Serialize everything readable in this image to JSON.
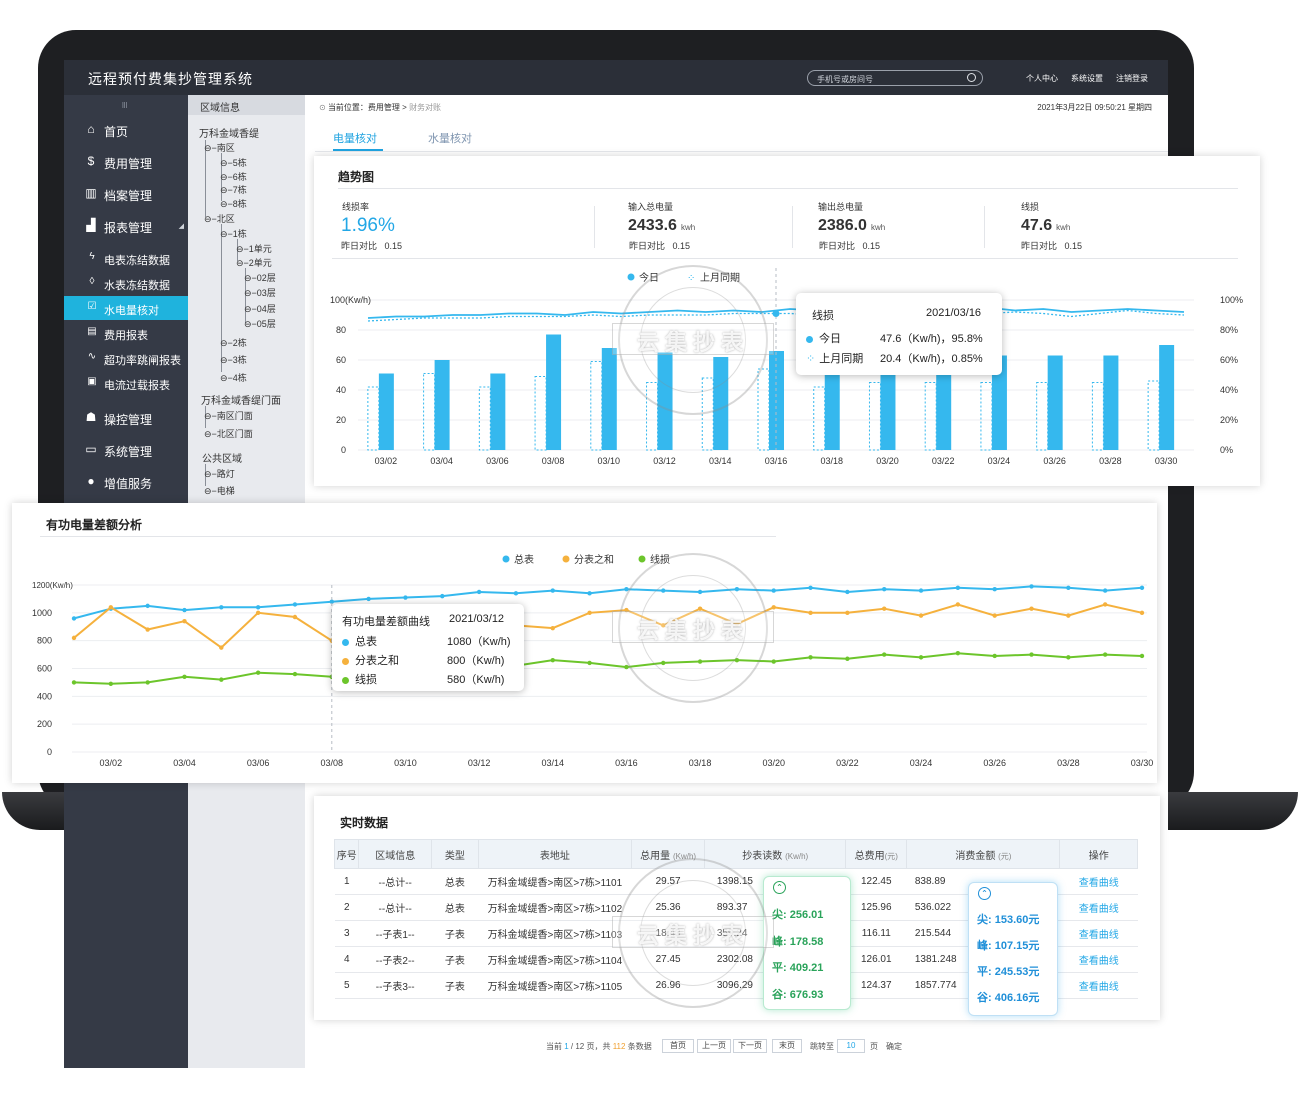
{
  "app": {
    "title": "远程预付费集抄管理系统",
    "search_placeholder": "手机号或房间号",
    "top_links": [
      "个人中心",
      "系统设置",
      "注销登录"
    ]
  },
  "sidebar": {
    "handle": "lll",
    "items": [
      {
        "label": "首页",
        "icon": "home-icon"
      },
      {
        "label": "费用管理",
        "icon": "dollar-icon"
      },
      {
        "label": "档案管理",
        "icon": "archive-icon"
      },
      {
        "label": "报表管理",
        "icon": "chart-icon"
      },
      {
        "label": "电表冻结数据",
        "icon": "lightning-icon"
      },
      {
        "label": "水表冻结数据",
        "icon": "water-drop-icon"
      },
      {
        "label": "水电量核对",
        "icon": "check-icon"
      },
      {
        "label": "费用报表",
        "icon": "report-icon"
      },
      {
        "label": "超功率跳闸报表",
        "icon": "pulse-icon"
      },
      {
        "label": "电流过载报表",
        "icon": "overload-icon"
      },
      {
        "label": "操控管理",
        "icon": "control-icon"
      },
      {
        "label": "系统管理",
        "icon": "monitor-icon"
      },
      {
        "label": "增值服务",
        "icon": "service-icon"
      }
    ]
  },
  "region": {
    "header": "区域信息",
    "tree": {
      "g1": "万科金域香缇",
      "south": "南区",
      "b5": "5栋",
      "b6": "6栋",
      "b7": "7栋",
      "b8": "8栋",
      "north": "北区",
      "n1": "1栋",
      "u1": "1单元",
      "u2": "2单元",
      "f2": "02层",
      "f3": "03层",
      "f4": "04层",
      "f5": "05层",
      "n2": "2栋",
      "n3": "3栋",
      "n4": "4栋",
      "g2": "万科金域香缇门面",
      "southShop": "南区门面",
      "northShop": "北区门面",
      "g3": "公共区域",
      "lamp": "路灯",
      "elevator": "电梯"
    }
  },
  "header": {
    "crumb_prefix": "当前位置：费用管理 > ",
    "crumb_current": "财务对账",
    "datetime": "2021年3月22日   09:50:21   星期四"
  },
  "tabs": [
    "电量核对",
    "水量核对"
  ],
  "trend": {
    "title": "趋势图",
    "kpis": [
      {
        "label": "线损率",
        "value": "1.96%",
        "compare_label": "昨日对比",
        "compare": "0.15"
      },
      {
        "label": "输入总电量",
        "value": "2433.6",
        "unit": "kwh",
        "compare_label": "昨日对比",
        "compare": "0.15"
      },
      {
        "label": "输出总电量",
        "value": "2386.0",
        "unit": "kwh",
        "compare_label": "昨日对比",
        "compare": "0.15"
      },
      {
        "label": "线损",
        "value": "47.6",
        "unit": "kwh",
        "compare_label": "昨日对比",
        "compare": "0.15"
      }
    ],
    "tooltip": {
      "title": "线损",
      "date": "2021/03/16",
      "rows": [
        {
          "name": "今日",
          "value": "47.6（Kw/h)，95.8%"
        },
        {
          "name": "上月同期",
          "value": "20.4（Kw/h)，0.85%"
        }
      ]
    }
  },
  "diff": {
    "title": "有功电量差额分析",
    "tooltip": {
      "title": "有功电量差额曲线",
      "date": "2021/03/12",
      "rows": [
        {
          "name": "总表",
          "value": "1080（Kw/h)"
        },
        {
          "name": "分表之和",
          "value": "800（Kw/h)"
        },
        {
          "name": "线损",
          "value": "580（Kw/h)"
        }
      ]
    }
  },
  "realtime": {
    "title": "实时数据",
    "headers": {
      "index": "序号",
      "region": "区域信息",
      "type": "类型",
      "address": "表地址",
      "usage": "总用量",
      "usage_unit": "(Kw/h)",
      "reading": "抄表读数",
      "reading_unit": "(Kw/h)",
      "fee": "总费用",
      "fee_unit": "(元)",
      "amount": "消费金额",
      "amount_unit": "(元)",
      "action": "操作"
    },
    "rows": [
      {
        "index": "1",
        "region": "--总计--",
        "type": "总表",
        "address": "万科金域缇香>南区>7栋>1101",
        "usage": "29.57",
        "reading": "1398.15",
        "fee": "122.45",
        "amount": "838.89",
        "action": "查看曲线"
      },
      {
        "index": "2",
        "region": "--总计--",
        "type": "总表",
        "address": "万科金域缇香>南区>7栋>1102",
        "usage": "25.36",
        "reading": "893.37",
        "fee": "125.96",
        "amount": "536.022",
        "action": "查看曲线"
      },
      {
        "index": "3",
        "region": "--子表1--",
        "type": "子表",
        "address": "万科金域缇香>南区>7栋>1103",
        "usage": "18.43",
        "reading": "359.24",
        "fee": "116.11",
        "amount": "215.544",
        "action": "查看曲线"
      },
      {
        "index": "4",
        "region": "--子表2--",
        "type": "子表",
        "address": "万科金域缇香>南区>7栋>1104",
        "usage": "27.45",
        "reading": "2302.08",
        "fee": "126.01",
        "amount": "1381.248",
        "action": "查看曲线"
      },
      {
        "index": "5",
        "region": "--子表3--",
        "type": "子表",
        "address": "万科金域缇香>南区>7栋>1105",
        "usage": "26.96",
        "reading": "3096.29",
        "fee": "124.37",
        "amount": "1857.774",
        "action": "查看曲线"
      }
    ],
    "reading_popup": [
      "尖: 256.01",
      "峰: 178.58",
      "平: 409.21",
      "谷: 676.93"
    ],
    "amount_popup": [
      "尖: 153.60元",
      "峰: 107.15元",
      "平: 245.53元",
      "谷: 406.16元"
    ]
  },
  "pager": {
    "info_prefix": "当前 ",
    "current": "1",
    "total_pages": " / 12 页，共 ",
    "total_items": "112",
    "items_suffix": " 条数据",
    "first": "首页",
    "prev": "上一页",
    "next": "下一页",
    "last": "末页",
    "goto": "跳转至",
    "page_input": "10",
    "page_word": "页",
    "confirm": "确定"
  },
  "watermark": {
    "text": "云集抄表"
  },
  "colors": {
    "accent": "#1fb3dd",
    "sidebar_bg": "#353a46",
    "series_total": "#35b8ee",
    "series_sub": "#f5b13d",
    "series_loss": "#6cc52b"
  },
  "chart_data": [
    {
      "type": "bar",
      "title": "趋势图",
      "categories": [
        "03/01",
        "03/02",
        "03/03",
        "03/04",
        "03/05",
        "03/06",
        "03/07",
        "03/08",
        "03/09",
        "03/10",
        "03/11",
        "03/12",
        "03/13",
        "03/14",
        "03/15",
        "03/16",
        "03/17",
        "03/18",
        "03/19",
        "03/20",
        "03/21",
        "03/22",
        "03/23",
        "03/24",
        "03/25",
        "03/26",
        "03/27",
        "03/28",
        "03/29",
        "03/30"
      ],
      "tick_labels": [
        "03/02",
        "03/04",
        "03/06",
        "03/08",
        "03/10",
        "03/12",
        "03/14",
        "03/16",
        "03/18",
        "03/20",
        "03/22",
        "03/24",
        "03/26",
        "03/28",
        "03/30"
      ],
      "y_unit": "100(Kw/h)",
      "ylim": [
        0,
        100
      ],
      "y_ticks": [
        "0",
        "20",
        "40",
        "60",
        "80"
      ],
      "y2_ticks": [
        "0%",
        "20%",
        "40%",
        "60%",
        "80%",
        "100%"
      ],
      "legend": [
        "今日",
        "上月同期"
      ],
      "legend_position": "top-center",
      "series": [
        {
          "name": "今日",
          "kind": "bar",
          "values": [
            51,
            60,
            51,
            77,
            68,
            65,
            62,
            66,
            56,
            58,
            63,
            63,
            63,
            63,
            70
          ]
        },
        {
          "name": "上月同期",
          "kind": "bar",
          "values": [
            42,
            51,
            42,
            49,
            59,
            45,
            48,
            54,
            42,
            45,
            45,
            45,
            45,
            45,
            46
          ]
        },
        {
          "name": "今日",
          "kind": "line",
          "axis": "right",
          "values": [
            88,
            89,
            89,
            90,
            90,
            91,
            91,
            90,
            92,
            91,
            92,
            93,
            92,
            93,
            92,
            94,
            93,
            95,
            93,
            94,
            92,
            93,
            95,
            93,
            94,
            92,
            93,
            94,
            93,
            92
          ]
        },
        {
          "name": "上月同期",
          "kind": "line",
          "axis": "right",
          "values": [
            86,
            87,
            88,
            88,
            88,
            89,
            89,
            89,
            90,
            89,
            90,
            90,
            90,
            91,
            91,
            91,
            90,
            92,
            92,
            91,
            93,
            92,
            91,
            92,
            91,
            89,
            91,
            93,
            91,
            90
          ]
        }
      ]
    },
    {
      "type": "line",
      "title": "有功电量差额分析",
      "categories": [
        "03/01",
        "03/02",
        "03/03",
        "03/04",
        "03/05",
        "03/06",
        "03/07",
        "03/08",
        "03/09",
        "03/10",
        "03/11",
        "03/12",
        "03/13",
        "03/14",
        "03/15",
        "03/16",
        "03/17",
        "03/18",
        "03/19",
        "03/20",
        "03/21",
        "03/22",
        "03/23",
        "03/24",
        "03/25",
        "03/26",
        "03/27",
        "03/28",
        "03/29",
        "03/30"
      ],
      "tick_labels": [
        "03/02",
        "03/04",
        "03/06",
        "03/08",
        "03/10",
        "03/12",
        "03/14",
        "03/16",
        "03/18",
        "03/20",
        "03/22",
        "03/24",
        "03/26",
        "03/28",
        "03/30"
      ],
      "y_unit": "1200(Kw/h)",
      "ylim": [
        0,
        1200
      ],
      "y_ticks": [
        "0",
        "200",
        "400",
        "600",
        "800",
        "1000"
      ],
      "legend": [
        "总表",
        "分表之和",
        "线损"
      ],
      "legend_position": "top-center",
      "series": [
        {
          "name": "总表",
          "values": [
            960,
            1030,
            1050,
            1020,
            1040,
            1040,
            1060,
            1080,
            1100,
            1110,
            1120,
            1150,
            1140,
            1160,
            1140,
            1170,
            1160,
            1150,
            1170,
            1160,
            1180,
            1150,
            1170,
            1160,
            1180,
            1170,
            1190,
            1180,
            1160,
            1180
          ]
        },
        {
          "name": "分表之和",
          "values": [
            820,
            1040,
            880,
            940,
            750,
            1000,
            970,
            800,
            880,
            870,
            1010,
            980,
            910,
            890,
            1000,
            1020,
            910,
            1030,
            920,
            1040,
            1000,
            1000,
            1030,
            980,
            1060,
            980,
            1030,
            980,
            1060,
            1000
          ]
        },
        {
          "name": "线损",
          "values": [
            500,
            490,
            500,
            540,
            520,
            570,
            560,
            540,
            560,
            580,
            620,
            600,
            620,
            660,
            640,
            610,
            640,
            650,
            660,
            650,
            680,
            670,
            700,
            680,
            710,
            690,
            700,
            680,
            700,
            690
          ]
        }
      ]
    }
  ]
}
